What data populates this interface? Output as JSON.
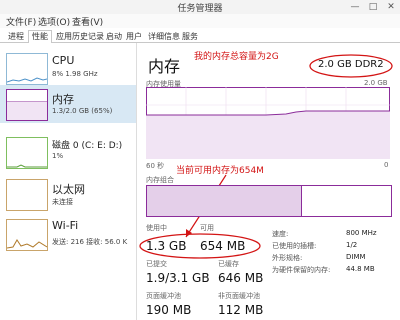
{
  "window": {
    "title": "任务管理器"
  },
  "menu": {
    "file": "文件(F)",
    "options": "选项(O)",
    "view": "查看(V)"
  },
  "tabs": [
    "进程",
    "性能",
    "应用历史记录",
    "启动",
    "用户",
    "详细信息",
    "服务"
  ],
  "sidebar": {
    "cpu": {
      "title": "CPU",
      "sub": "8% 1.98 GHz"
    },
    "memory": {
      "title": "内存",
      "sub": "1.3/2.0 GB (65%)"
    },
    "disk": {
      "title": "磁盘 0 (C: E: D:)",
      "sub": "1%"
    },
    "ethernet": {
      "title": "以太网",
      "sub": "未连接"
    },
    "wifi": {
      "title": "Wi-Fi",
      "sub": "发送: 216 接收: 56.0 K"
    }
  },
  "main": {
    "title": "内存",
    "total": "2.0 GB DDR2",
    "graph_label": "内存使用量",
    "graph_max": "2.0 GB",
    "seconds": "60 秒",
    "zero": "0",
    "composition_label": "内存组合"
  },
  "annotations": {
    "total_note": "我的内存总容量为2G",
    "available_note": "当前可用内存为654M"
  },
  "stats": {
    "in_use": {
      "label": "使用中",
      "value": "1.3 GB"
    },
    "available": {
      "label": "可用",
      "value": "654 MB"
    },
    "committed": {
      "label": "已提交",
      "value": "1.9/3.1 GB"
    },
    "cached": {
      "label": "已缓存",
      "value": "646 MB"
    },
    "paged_pool": {
      "label": "页面缓冲池",
      "value": "190 MB"
    },
    "nonpaged_pool": {
      "label": "非页面缓冲池",
      "value": "112 MB"
    }
  },
  "specs": {
    "speed": {
      "label": "速度:",
      "value": "800 MHz"
    },
    "slots": {
      "label": "已使用的插槽:",
      "value": "1/2"
    },
    "form": {
      "label": "外形规格:",
      "value": "DIMM"
    },
    "reserved": {
      "label": "为硬件保留的内存:",
      "value": "44.8 MB"
    }
  },
  "memory_usage_fraction": 0.65,
  "colors": {
    "memory_purple": "#8b2c9a",
    "annotation_red": "#d31414",
    "selection_blue": "#d8e8f4"
  }
}
